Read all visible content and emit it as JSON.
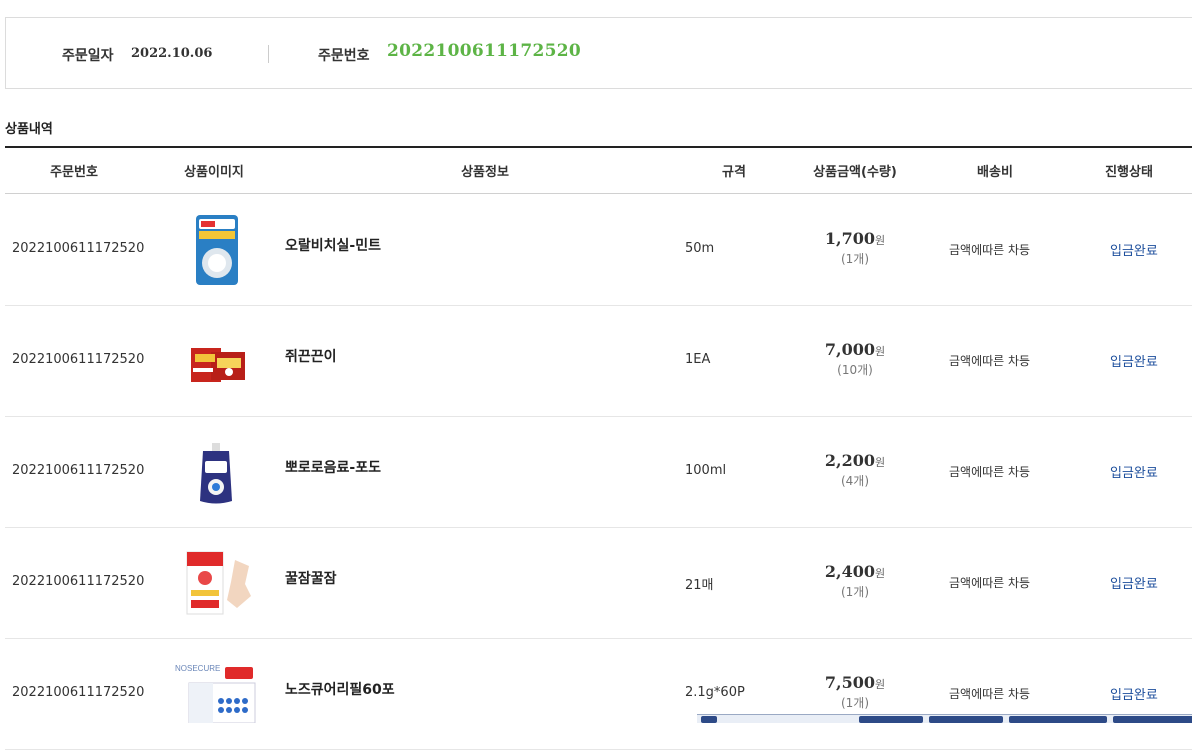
{
  "order_summary": {
    "date_label": "주문일자",
    "date_value": "2022.10.06",
    "number_label": "주문번호",
    "number_value": "2022100611172520"
  },
  "section_title": "상품내역",
  "table": {
    "headers": [
      "주문번호",
      "상품이미지",
      "상품정보",
      "규격",
      "상품금액(수량)",
      "배송비",
      "진행상태"
    ],
    "rows": [
      {
        "order_no": "2022100611172520",
        "name": "오랄비치실-민트",
        "spec": "50m",
        "price": "1,700",
        "unit": "원",
        "qty": "(1개)",
        "shipping": "금액에따른 차등",
        "status": "입금완료",
        "image_icon": "dental-floss-icon"
      },
      {
        "order_no": "2022100611172520",
        "name": "쥐끈끈이",
        "spec": "1EA",
        "price": "7,000",
        "unit": "원",
        "qty": "(10개)",
        "shipping": "금액에따른 차등",
        "status": "입금완료",
        "image_icon": "mouse-trap-icon"
      },
      {
        "order_no": "2022100611172520",
        "name": "뽀로로음료-포도",
        "spec": "100ml",
        "price": "2,200",
        "unit": "원",
        "qty": "(4개)",
        "shipping": "금액에따른 차등",
        "status": "입금완료",
        "image_icon": "juice-pouch-icon"
      },
      {
        "order_no": "2022100611172520",
        "name": "꿀잠꿀잠",
        "spec": "21매",
        "price": "2,400",
        "unit": "원",
        "qty": "(1개)",
        "shipping": "금액에따른 차등",
        "status": "입금완료",
        "image_icon": "sleep-patch-icon"
      },
      {
        "order_no": "2022100611172520",
        "name": "노즈큐어리필60포",
        "spec": "2.1g*60P",
        "price": "7,500",
        "unit": "원",
        "qty": "(1개)",
        "shipping": "금액에따른 차등",
        "status": "입금완료",
        "image_icon": "nose-strip-icon",
        "brand_text": "NOSECURE"
      }
    ]
  },
  "colors": {
    "order_number": "#5db446",
    "status_link": "#1c4e9c",
    "header_rule": "#222222"
  }
}
